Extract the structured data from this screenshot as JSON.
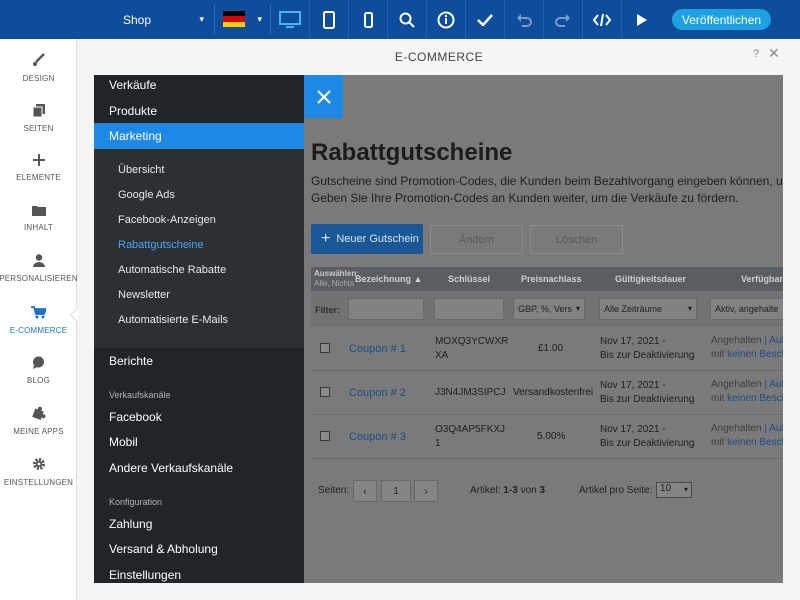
{
  "topbar": {
    "site_label": "Shop",
    "language_flag": "flag-de-icon",
    "icons": [
      "desktop-icon",
      "tablet-icon",
      "mobile-icon",
      "search-icon",
      "info-icon",
      "check-icon",
      "undo-icon",
      "redo-icon",
      "code-icon",
      "play-icon"
    ],
    "publish_label": "Veröffentlichen"
  },
  "sidebar": {
    "items": [
      {
        "label": "DESIGN",
        "icon": "brush-icon"
      },
      {
        "label": "SEITEN",
        "icon": "pages-icon"
      },
      {
        "label": "ELEMENTE",
        "icon": "plus-icon"
      },
      {
        "label": "INHALT",
        "icon": "folder-icon"
      },
      {
        "label": "PERSONALISIEREN",
        "icon": "person-icon"
      },
      {
        "label": "E-COMMERCE",
        "icon": "cart-icon",
        "active": true
      },
      {
        "label": "BLOG",
        "icon": "speech-bubble-icon"
      },
      {
        "label": "MEINE APPS",
        "icon": "puzzle-icon"
      },
      {
        "label": "EINSTELLUNGEN",
        "icon": "gear-icon"
      }
    ]
  },
  "panel": {
    "title": "E-COMMERCE",
    "help": "?",
    "close": "✕"
  },
  "nav": {
    "top_items": [
      "Verkäufe",
      "Produkte",
      "Marketing"
    ],
    "marketing_sub": [
      "Übersicht",
      "Google Ads",
      "Facebook-Anzeigen",
      "Rabattgutscheine",
      "Automatische Rabatte",
      "Newsletter",
      "Automatisierte E-Mails"
    ],
    "berichte": "Berichte",
    "heading_channels": "Verkaufskanäle",
    "channels": [
      "Facebook",
      "Mobil",
      "Andere Verkaufskanäle"
    ],
    "heading_config": "Konfiguration",
    "config": [
      "Zahlung",
      "Versand & Abholung",
      "Einstellungen"
    ]
  },
  "content": {
    "title": "Rabattgutscheine",
    "desc_line1": "Gutscheine sind Promotion-Codes, die Kunden beim Bezahlvorgang eingeben können, um e",
    "desc_line2": "Geben Sie Ihre Promotion-Codes an Kunden weiter, um die Verkäufe zu fördern.",
    "btn_new": "Neuer Gutschein",
    "btn_change": "Ändern",
    "btn_delete": "Löschen",
    "table": {
      "select_label": "Auswählen:",
      "select_sub": "Alle, Nichts",
      "headers": [
        "Bezeichnung ▲",
        "Schlüssel",
        "Preisnachlass",
        "Gültigkeitsdauer",
        "Verfügbar"
      ],
      "filter_label": "Filter:",
      "filters": [
        "",
        "",
        "GBP, %, Vers",
        "Alle Zeiträume",
        "Aktiv, angehalte"
      ],
      "rows": [
        {
          "name": "Coupon # 1",
          "key1": "MOXQ3YCWXR",
          "key2": "XA",
          "discount": "£1.00",
          "validity1": "Nov 17, 2021 -",
          "validity2": "Bis zur Deaktivierung",
          "status1a": "Angehalten",
          "status1b": "| Auf",
          "status2a": "mit",
          "status2b": "keinen Besch"
        },
        {
          "name": "Coupon # 2",
          "key1": "J3N4JM3SIPCJ",
          "key2": "",
          "discount": "Versandkostenfrei",
          "validity1": "Nov 17, 2021 -",
          "validity2": "Bis zur Deaktivierung",
          "status1a": "Angehalten",
          "status1b": "| Auf",
          "status2a": "mit",
          "status2b": "keinen Besch"
        },
        {
          "name": "Coupon # 3",
          "key1": "O3Q4AP5FKXJ",
          "key2": "1",
          "discount": "5.00%",
          "validity1": "Nov 17, 2021 -",
          "validity2": "Bis zur Deaktivierung",
          "status1a": "Angehalten",
          "status1b": "| Auf",
          "status2a": "mit",
          "status2b": "keinen Besch"
        }
      ]
    },
    "pager": {
      "pages_label": "Seiten:",
      "page": "1",
      "articles_prefix": "Artikel:",
      "articles_range": "1-3",
      "articles_of": "von",
      "articles_total": "3",
      "per_page_label": "Artikel pro Seite:",
      "per_page": "10"
    }
  }
}
